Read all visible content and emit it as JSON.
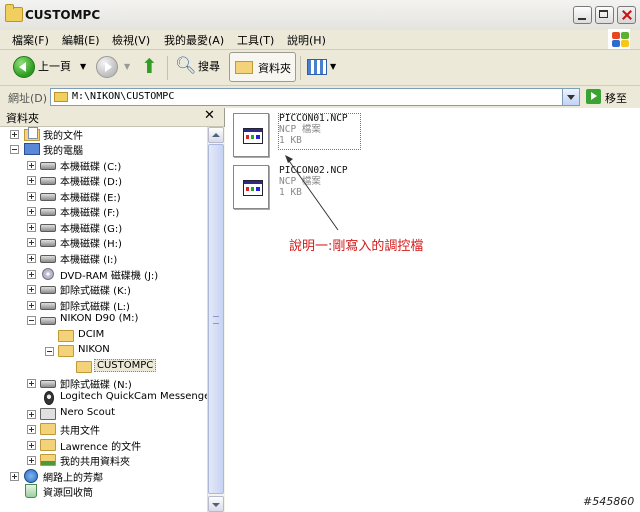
{
  "window": {
    "title": "CUSTOMPC"
  },
  "menu": [
    "檔案(F)",
    "編輯(E)",
    "檢視(V)",
    "我的最愛(A)",
    "工具(T)",
    "說明(H)"
  ],
  "toolbar": {
    "back_label": "上一頁",
    "search_label": "搜尋",
    "folders_label": "資料夾"
  },
  "address": {
    "label": "網址(D)",
    "path": "M:\\NIKON\\CUSTOMPC",
    "go_label": "移至"
  },
  "folders_pane": {
    "title": "資料夾",
    "close_symbol": "✕",
    "items": [
      {
        "label": "我的文件",
        "icon": "documents-icon"
      },
      {
        "label": "我的電腦",
        "icon": "computer-icon"
      },
      {
        "label": "本機磁碟 (C:)",
        "icon": "drive-icon"
      },
      {
        "label": "本機磁碟 (D:)",
        "icon": "drive-icon"
      },
      {
        "label": "本機磁碟 (E:)",
        "icon": "drive-icon"
      },
      {
        "label": "本機磁碟 (F:)",
        "icon": "drive-icon"
      },
      {
        "label": "本機磁碟 (G:)",
        "icon": "drive-icon"
      },
      {
        "label": "本機磁碟 (H:)",
        "icon": "drive-icon"
      },
      {
        "label": "本機磁碟 (I:)",
        "icon": "drive-icon"
      },
      {
        "label": "DVD-RAM 磁碟機 (J:)",
        "icon": "dvd-drive-icon"
      },
      {
        "label": "卸除式磁碟 (K:)",
        "icon": "removable-drive-icon"
      },
      {
        "label": "卸除式磁碟 (L:)",
        "icon": "removable-drive-icon"
      },
      {
        "label": "NIKON D90 (M:)",
        "icon": "removable-drive-icon"
      },
      {
        "label": "DCIM",
        "icon": "folder-icon"
      },
      {
        "label": "NIKON",
        "icon": "folder-icon"
      },
      {
        "label": "CUSTOMPC",
        "icon": "folder-open-icon"
      },
      {
        "label": "卸除式磁碟 (N:)",
        "icon": "removable-drive-icon"
      },
      {
        "label": "Logitech QuickCam Messenger",
        "icon": "webcam-icon"
      },
      {
        "label": "Nero Scout",
        "icon": "nero-icon"
      },
      {
        "label": "共用文件",
        "icon": "folder-icon"
      },
      {
        "label": "Lawrence 的文件",
        "icon": "folder-icon"
      },
      {
        "label": "我的共用資料夾",
        "icon": "shared-folder-icon"
      },
      {
        "label": "網路上的芳鄰",
        "icon": "network-icon"
      },
      {
        "label": "資源回收筒",
        "icon": "recycle-bin-icon"
      }
    ]
  },
  "files": [
    {
      "name": "PICCON01.NCP",
      "type": "NCP 檔案",
      "size": "1 KB"
    },
    {
      "name": "PICCON02.NCP",
      "type": "NCP 檔案",
      "size": "1 KB"
    }
  ],
  "annotation": "說明一:剛寫入的調控檔",
  "watermark": "#545860",
  "colors": {
    "annotation": "#d41a1a",
    "selection_bg": "#ece9d8"
  }
}
